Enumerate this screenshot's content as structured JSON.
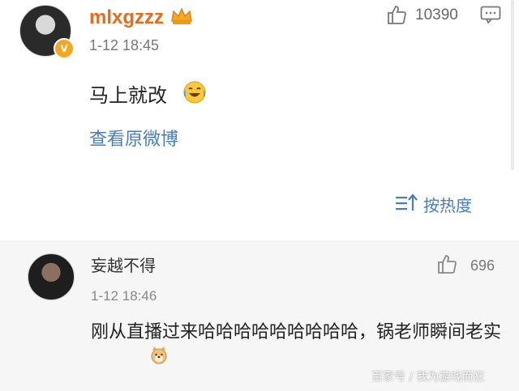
{
  "post": {
    "username": "mlxgzzz",
    "time": "1-12 18:45",
    "likes": "10390",
    "content": "马上就改",
    "view_original": "查看原微博",
    "sort_label": "按热度"
  },
  "comment": {
    "username": "妄越不得",
    "time": "1-12 18:46",
    "likes": "696",
    "text": "刚从直播过来哈哈哈哈哈哈哈哈哈，锅老师瞬间老实"
  },
  "watermark": "百家号 / 我为游戏而狂",
  "icons": {
    "verify": "verified-v-icon",
    "crown": "crown-icon",
    "like": "thumbs-up-icon",
    "comment": "comment-icon",
    "laugh": "laugh-cry-emoji",
    "sort": "sort-icon",
    "doge": "doge-emoji"
  },
  "colors": {
    "username": "#e86b1a",
    "link": "#4a7eb7"
  }
}
